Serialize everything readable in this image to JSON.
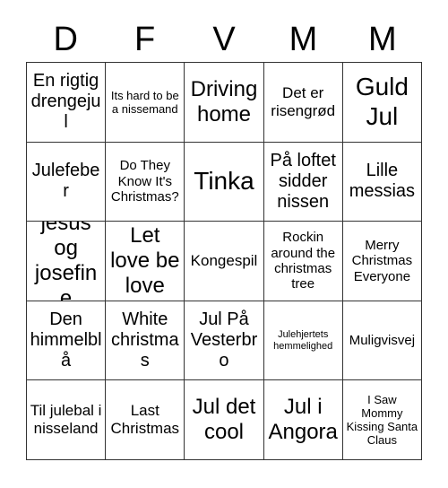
{
  "card": {
    "type": "bingo-card",
    "columns": 5,
    "rows": 5,
    "border_color": "#333333",
    "background_color": "#ffffff",
    "text_color": "#000000",
    "header": {
      "letters": [
        "D",
        "F",
        "V",
        "M",
        "M"
      ]
    },
    "cells": [
      [
        {
          "text": "En rigtig drengejul",
          "size": "lg"
        },
        {
          "text": "Its hard to be a nissemand",
          "size": "xs"
        },
        {
          "text": "Driving home",
          "size": "xl"
        },
        {
          "text": "Det er risengrød",
          "size": "md"
        },
        {
          "text": "Guld Jul",
          "size": "xxl"
        }
      ],
      [
        {
          "text": "Julefeber",
          "size": "lg"
        },
        {
          "text": "Do They Know It's Christmas?",
          "size": "sm"
        },
        {
          "text": "Tinka",
          "size": "xxl"
        },
        {
          "text": "På loftet sidder nissen",
          "size": "lg"
        },
        {
          "text": "Lille messias",
          "size": "lg"
        }
      ],
      [
        {
          "text": "jesus og josefine",
          "size": "xl"
        },
        {
          "text": "Let love be love",
          "size": "xl"
        },
        {
          "text": "Kongespil",
          "size": "md"
        },
        {
          "text": "Rockin around the christmas tree",
          "size": "sm"
        },
        {
          "text": "Merry Christmas Everyone",
          "size": "sm"
        }
      ],
      [
        {
          "text": "Den himmelblå",
          "size": "lg"
        },
        {
          "text": "White christmas",
          "size": "lg"
        },
        {
          "text": "Jul På Vesterbro",
          "size": "lg"
        },
        {
          "text": "Julehjertets hemmelighed",
          "size": "xxs"
        },
        {
          "text": "Muligvisvej",
          "size": "sm"
        }
      ],
      [
        {
          "text": "Til julebal i nisseland",
          "size": "md"
        },
        {
          "text": "Last Christmas",
          "size": "md"
        },
        {
          "text": "Jul det cool",
          "size": "xl"
        },
        {
          "text": "Jul i Angora",
          "size": "xl"
        },
        {
          "text": "I Saw Mommy Kissing Santa Claus",
          "size": "xs"
        }
      ]
    ]
  }
}
